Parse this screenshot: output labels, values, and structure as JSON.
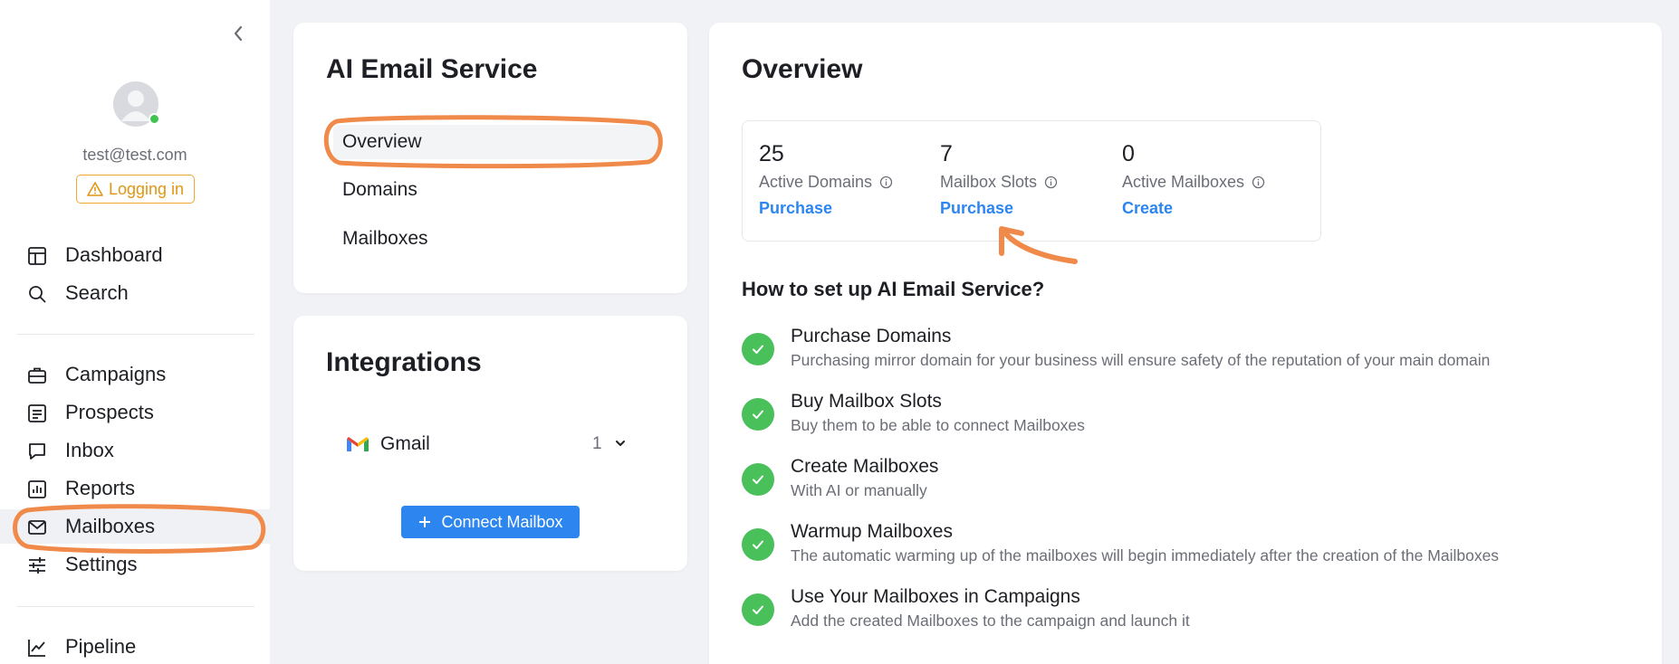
{
  "sidebar": {
    "user_email": "test@test.com",
    "login_badge": "Logging in",
    "items": [
      {
        "label": "Dashboard",
        "icon": "dashboard-icon"
      },
      {
        "label": "Search",
        "icon": "search-icon"
      },
      {
        "label": "Campaigns",
        "icon": "briefcase-icon"
      },
      {
        "label": "Prospects",
        "icon": "list-icon"
      },
      {
        "label": "Inbox",
        "icon": "chat-icon"
      },
      {
        "label": "Reports",
        "icon": "bar-chart-icon"
      },
      {
        "label": "Mailboxes",
        "icon": "envelope-icon"
      },
      {
        "label": "Settings",
        "icon": "sliders-icon"
      },
      {
        "label": "Pipeline",
        "icon": "line-chart-icon"
      }
    ],
    "active_item": "Mailboxes"
  },
  "service_card": {
    "title": "AI Email Service",
    "items": [
      "Overview",
      "Domains",
      "Mailboxes"
    ],
    "active_item": "Overview"
  },
  "integrations_card": {
    "title": "Integrations",
    "gmail_label": "Gmail",
    "gmail_count": "1",
    "connect_label": "Connect Mailbox"
  },
  "overview": {
    "title": "Overview",
    "stats": [
      {
        "value": "25",
        "label": "Active Domains",
        "link": "Purchase"
      },
      {
        "value": "7",
        "label": "Mailbox Slots",
        "link": "Purchase"
      },
      {
        "value": "0",
        "label": "Active Mailboxes",
        "link": "Create"
      }
    ],
    "setup_title": "How to set up AI Email Service?",
    "steps": [
      {
        "title": "Purchase Domains",
        "desc": "Purchasing mirror domain for your business will ensure safety of the reputation of your main domain"
      },
      {
        "title": "Buy Mailbox Slots",
        "desc": "Buy them to be able to connect Mailboxes"
      },
      {
        "title": "Create Mailboxes",
        "desc": "With AI or manually"
      },
      {
        "title": "Warmup Mailboxes",
        "desc": "The automatic warming up of the mailboxes will begin immediately after the creation of the Mailboxes"
      },
      {
        "title": "Use Your Mailboxes in Campaigns",
        "desc": "Add the created Mailboxes to the campaign and launch it"
      }
    ]
  },
  "colors": {
    "accent": "#2d86f0",
    "success": "#49c05a",
    "warning": "#f0a830",
    "annotation": "#f08a4b"
  }
}
